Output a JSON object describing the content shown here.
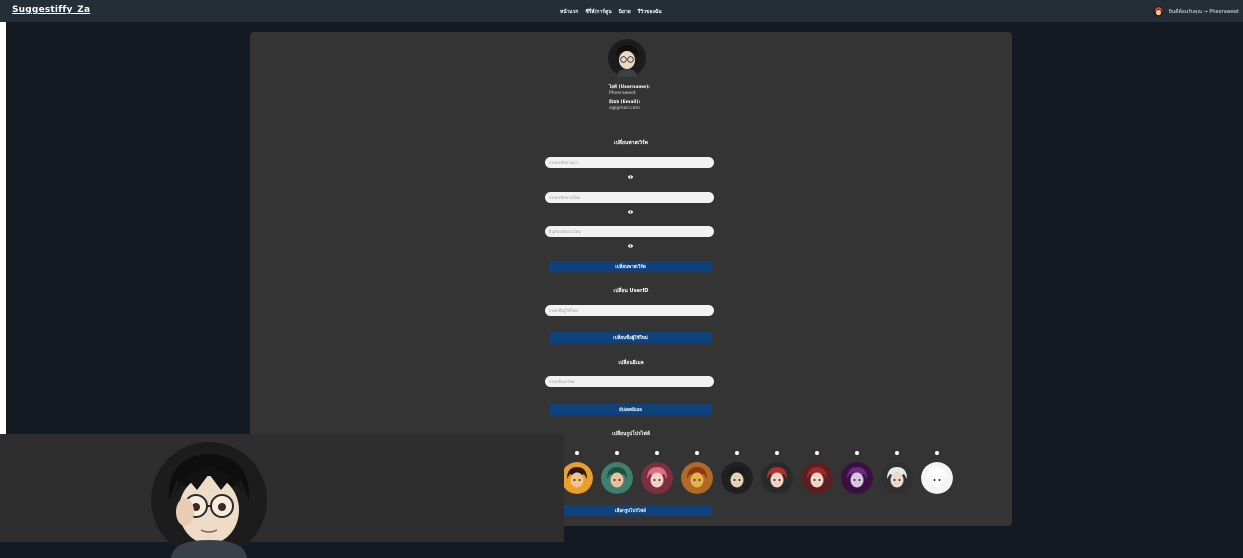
{
  "header": {
    "brand": "Suggestiffy_Za",
    "nav": [
      "หน้าแรก",
      "ซีรี่ส์/การ์ตูน",
      "นิยาย",
      "รีวิวของฉัน"
    ],
    "user_link": "ยินดีต้อนรับคุณ → Pheeraweet"
  },
  "profile": {
    "username_label": "ไอดี (Username):",
    "username_value": "Pheeraweet",
    "email_label": "อีเมล (Email):",
    "email_value": "a@gmail.com"
  },
  "password_section": {
    "title": "เปลี่ยนพาสเวิร์ด",
    "current_placeholder": "กรอกรหัสผ่านเก่า",
    "new_placeholder": "กรอกรหัสผ่านใหม่",
    "confirm_placeholder": "ยืนยันรหัสผ่านใหม่",
    "button": "เปลี่ยนพาสเวิร์ด"
  },
  "userid_section": {
    "title": "เปลี่ยน UserID",
    "placeholder": "กรอกชื่อผู้ใช้ใหม่",
    "button": "เปลี่ยนชื่อผู้ใช้ใหม่"
  },
  "email_section": {
    "title": "เปลี่ยนอีเมล",
    "placeholder": "กรอกอีเมลใหม่",
    "button": "อัปเดตอีเมล"
  },
  "avatar_section": {
    "title": "เปลี่ยนรูปโปรไฟล์",
    "button": "เลือกรูปโปรไฟล์",
    "avatars": [
      {
        "name": "orange-character-avatar",
        "bg": "#e8a02a",
        "hair": "#2a1a0e",
        "skin": "#f2c38a"
      },
      {
        "name": "green-hooded-avatar",
        "bg": "#3f7f6f",
        "hair": "#1f4f3f",
        "skin": "#e8c09a"
      },
      {
        "name": "pink-hair-avatar",
        "bg": "#7a3040",
        "hair": "#e06a8a",
        "skin": "#f4d0c0"
      },
      {
        "name": "burger-avatar",
        "bg": "#b06a28",
        "hair": "#8a3a12",
        "skin": "#e8b048"
      },
      {
        "name": "glasses-boy-avatar",
        "bg": "#202020",
        "hair": "#1a1a1a",
        "skin": "#e8d0b8"
      },
      {
        "name": "red-hair-boy-avatar",
        "bg": "#2a2a2a",
        "hair": "#b0302a",
        "skin": "#f2d2c0"
      },
      {
        "name": "red-hair-girl-avatar",
        "bg": "#5a2020",
        "hair": "#a02828",
        "skin": "#f4d4c8"
      },
      {
        "name": "purple-cloak-avatar",
        "bg": "#3a1040",
        "hair": "#6a2a80",
        "skin": "#d8c8e0"
      },
      {
        "name": "white-hair-avatar",
        "bg": "#303030",
        "hair": "#e8e8e8",
        "skin": "#f0d8c8"
      },
      {
        "name": "lucky-cat-avatar",
        "bg": "#f4f4f4",
        "hair": "#ffffff",
        "skin": "#ffffff"
      }
    ]
  },
  "colors": {
    "page_bg": "#131a21",
    "header_bg": "#232e37",
    "panel_bg": "#343434",
    "button_bg": "#0f417c"
  }
}
